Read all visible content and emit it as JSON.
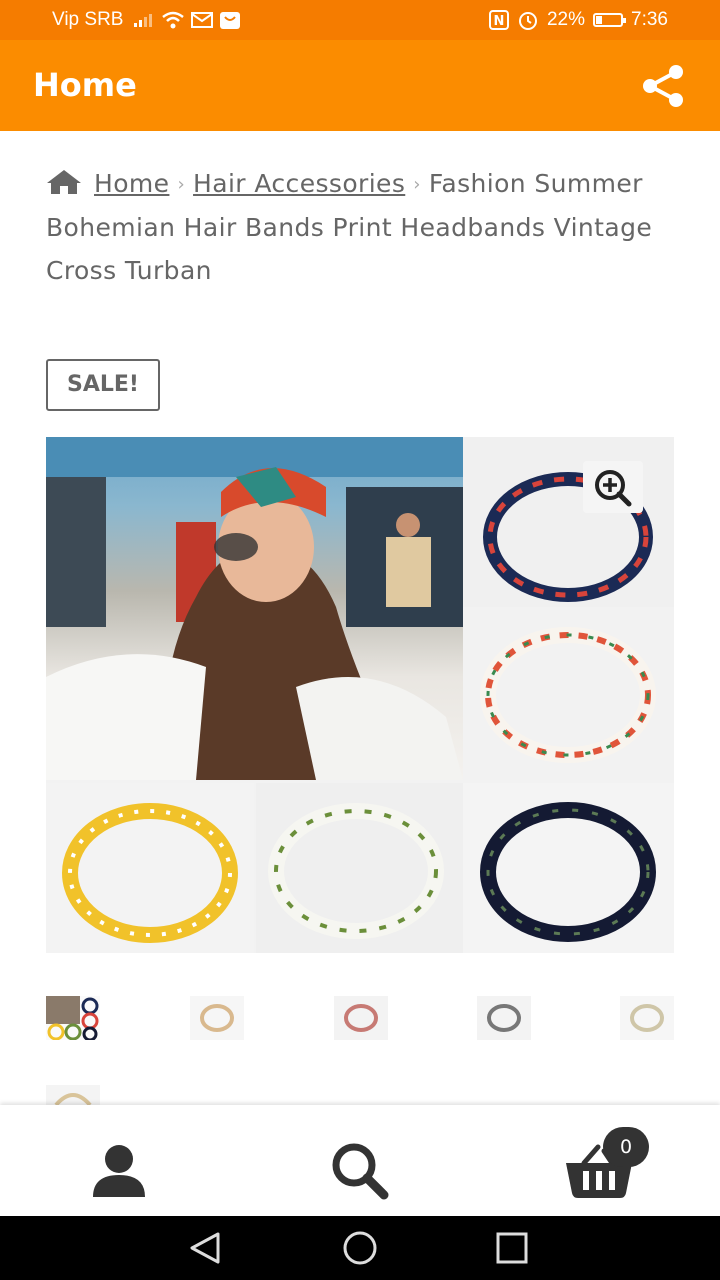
{
  "status_bar": {
    "carrier": "Vip SRB",
    "battery_percent": "22%",
    "battery_level": 0.22,
    "time": "7:36"
  },
  "app_bar": {
    "title": "Home",
    "share_icon": "share-icon"
  },
  "breadcrumb": {
    "home_icon": "home-icon",
    "items": [
      "Home",
      "Hair Accessories"
    ],
    "current": "Fashion Summer Bohemian Hair Bands Print Headbands Vintage Cross Turban"
  },
  "product": {
    "sale_label": "SALE!",
    "zoom_icon": "zoom-in-icon",
    "thumbnail_count": 6
  },
  "bottom_nav": {
    "items": [
      "account-icon",
      "search-icon",
      "cart-icon"
    ],
    "cart_count": "0"
  },
  "system_nav": [
    "back-icon",
    "home-circle-icon",
    "recents-icon"
  ],
  "colors": {
    "status_bar": "#f57c00",
    "app_bar": "#fb8c00",
    "text": "#666666"
  }
}
